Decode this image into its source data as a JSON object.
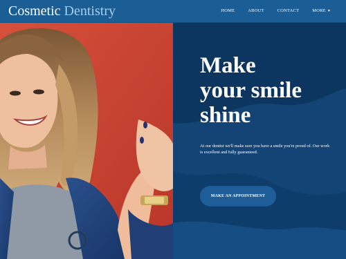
{
  "navbar": {
    "brand_main": "Cosmetic",
    "brand_accent": "Dentistry",
    "links": [
      {
        "label": "HOME"
      },
      {
        "label": "ABOUT"
      },
      {
        "label": "CONTACT"
      },
      {
        "label": "MORE"
      }
    ]
  },
  "hero": {
    "headline_lines": [
      "Make",
      "your smile",
      "shine"
    ],
    "tagline": "At our dentist we'll make sure you have a smile you're proud of. Our work is excellent and fully guaranteed.",
    "cta_label": "MAKE AN APPOINTMENT"
  },
  "colors": {
    "navbar": "#1b5e96",
    "brand_accent": "#a9cdec",
    "hero_bg": "#0c3560",
    "cta_bg": "#1e5d97",
    "photo_bg": "#d24a34"
  },
  "icons": {
    "more_caret": "caret-down-icon"
  }
}
